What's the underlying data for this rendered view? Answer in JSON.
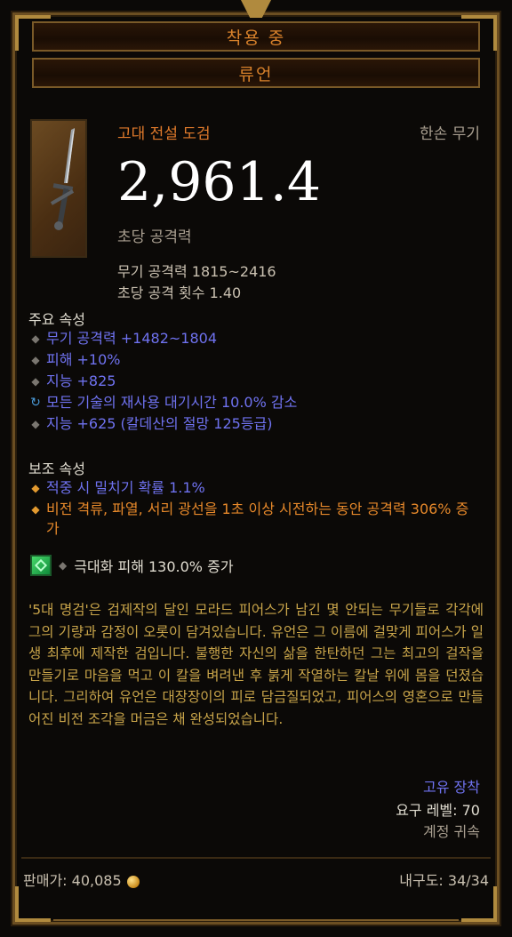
{
  "header": {
    "equipped_label": "착용 중",
    "item_name": "류언"
  },
  "item": {
    "type": "고대 전설 도검",
    "slot": "한손 무기",
    "dps_value": "2,961.4",
    "dps_label": "초당 공격력",
    "weapon_damage": "무기 공격력 1815~2416",
    "attack_speed": "초당 공격 횟수 1.40"
  },
  "primary": {
    "title": "주요 속성",
    "affixes": [
      "무기 공격력 +1482~1804",
      "피해 +10%",
      "지능 +825",
      "모든 기술의 재사용 대기시간 10.0% 감소",
      "지능 +625 (칼데산의 절망 125등급)"
    ]
  },
  "secondary": {
    "title": "보조 속성",
    "affixes": [
      "적중 시 밀치기 확률 1.1%",
      "비전 격류, 파열, 서리 광선을 1초 이상 시전하는 동안 공격력 306% 증가"
    ]
  },
  "gem": {
    "icon": "emerald-gem-icon",
    "text": "극대화 피해 130.0% 증가"
  },
  "flavor_text": "'5대 명검'은 검제작의 달인 모라드 피어스가 남긴 몇 안되는 무기들로 각각에 그의 기량과 감정이 오롯이 담겨있습니다. 유언은 그 이름에 걸맞게 피어스가 일생 최후에 제작한 검입니다. 불행한 자신의 삶을 한탄하던 그는 최고의 걸작을 만들기로 마음을 먹고 이 칼을 벼려낸 후 붉게 작열하는 칼날 위에 몸을 던졌습니다. 그리하여 유언은 대장장이의 피로 담금질되었고, 피어스의 영혼으로 만들어진 비전 조각을 머금은 채 완성되었습니다.",
  "requirements": {
    "unique": "고유 장착",
    "level": "요구 레벨: 70",
    "bind": "계정 귀속"
  },
  "footer": {
    "sell_price": "판매가: 40,085",
    "durability": "내구도: 34/34"
  },
  "colors": {
    "legendary": "#e07a2b",
    "magic_blue": "#6f72f0",
    "flavor_gold": "#c9a54a",
    "border_gold": "#b08a3e"
  }
}
